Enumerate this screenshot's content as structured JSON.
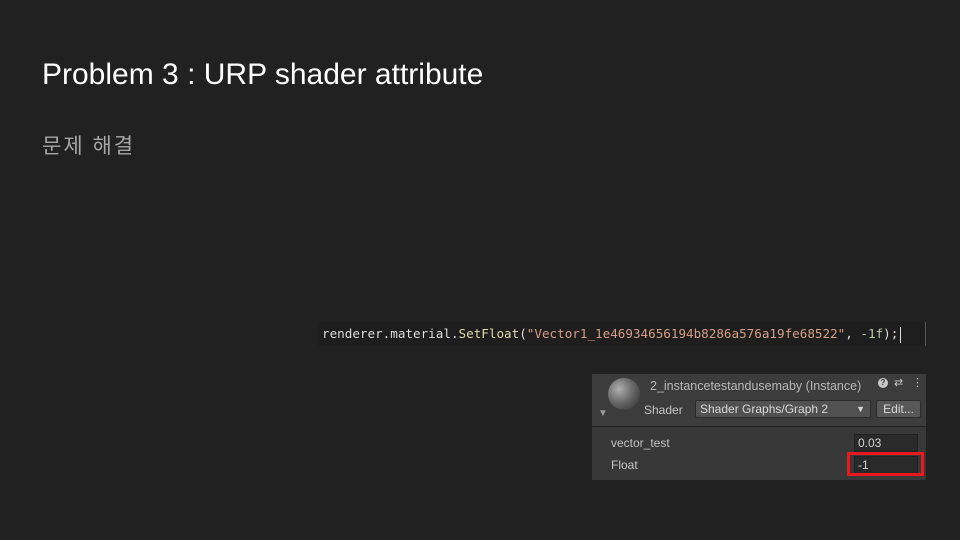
{
  "slide": {
    "title": "Problem 3 : URP shader attribute",
    "subtitle": "문제 해결"
  },
  "code": {
    "object": "renderer",
    "dot1": ".",
    "property": "material",
    "dot2": ".",
    "method": "SetFloat",
    "open_paren": "(",
    "string_arg": "\"Vector1_1e46934656194b8286a576a19fe68522\"",
    "comma": ", ",
    "number_arg": "-1f",
    "close": ");"
  },
  "inspector": {
    "material_name": "2_instancetestandusemaby (Instance)",
    "shader_label": "Shader",
    "shader_value": "Shader Graphs/Graph 2",
    "edit_label": "Edit...",
    "help_icon": "?",
    "preset_icon": "⇄",
    "menu_icon": "⋮",
    "properties": [
      {
        "label": "vector_test",
        "value": "0.03"
      },
      {
        "label": "Float",
        "value": "-1"
      }
    ]
  },
  "colors": {
    "background": "#212121",
    "highlight": "#e8191e"
  }
}
